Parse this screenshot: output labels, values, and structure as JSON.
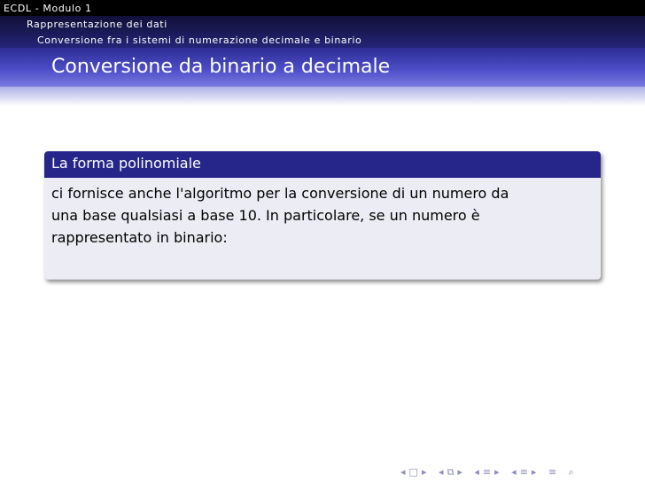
{
  "headline": {
    "course": "ECDL - Modulo 1",
    "section": "Rappresentazione dei dati",
    "subsection": "Conversione fra i sistemi di numerazione decimale e binario"
  },
  "frame": {
    "title": "Conversione da binario a decimale"
  },
  "block": {
    "title": "La forma polinomiale",
    "lines": [
      "ci fornisce anche l'algoritmo per la conversione di un numero da",
      "una base qualsiasi a base 10. In particolare, se un numero è",
      "rappresentato in binario:"
    ]
  },
  "navigation": {
    "icons": [
      "prev-slide-icon",
      "slide-icon",
      "next-slide-icon",
      "prev-frame-icon",
      "frame-icon",
      "next-frame-icon",
      "prev-subsection-icon",
      "subsection-icon",
      "next-subsection-icon",
      "prev-section-icon",
      "section-icon",
      "next-section-icon",
      "align-icon",
      "search-icon"
    ],
    "color": "#8c8cbf"
  },
  "colors": {
    "header_dark": "#000000",
    "title_bar": "#4c4cc8",
    "block_title": "#26268a",
    "block_body": "#ececf4"
  }
}
